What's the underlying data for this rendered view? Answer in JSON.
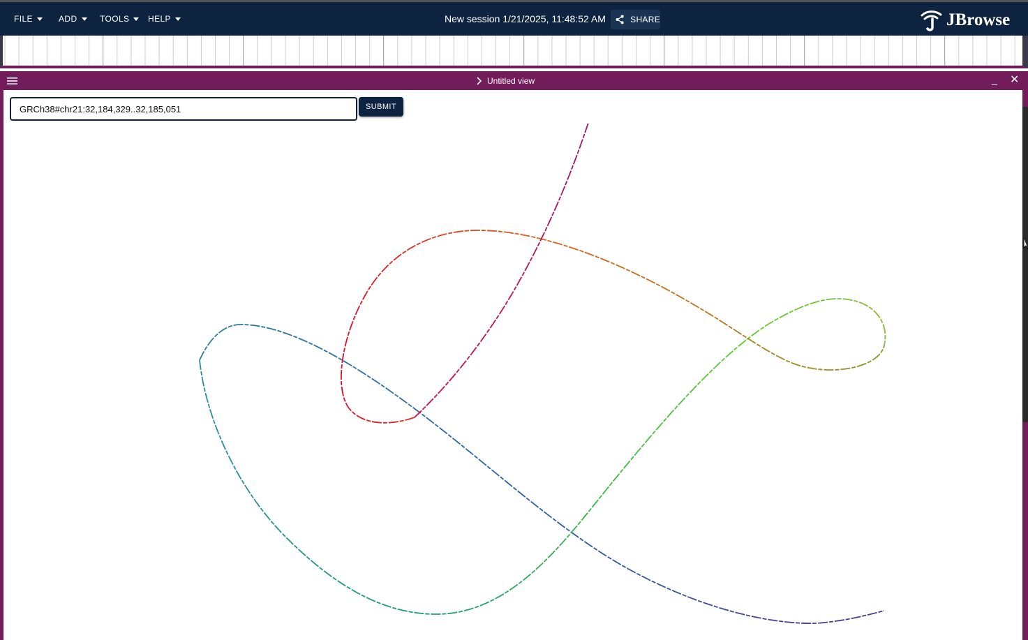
{
  "header": {
    "menus": [
      {
        "label": "FILE"
      },
      {
        "label": "ADD"
      },
      {
        "label": "TOOLS"
      },
      {
        "label": "HELP"
      }
    ],
    "session_title": "New session 1/21/2025, 11:48:52 AM",
    "share_label": "SHARE",
    "logo_text": "JBrowse"
  },
  "view": {
    "title": "Untitled view",
    "location_value": "GRCh38#chr21:32,184,329..32,185,051",
    "submit_label": "SUBMIT"
  },
  "colors": {
    "appbar": "#0d233f",
    "view_frame": "#721c5c",
    "accent": "#0d233f"
  },
  "icons": [
    "caret-down-icon",
    "share-icon",
    "jbrowse-logo-icon",
    "hamburger-icon",
    "chevron-right-icon",
    "minimize-icon",
    "close-icon"
  ]
}
